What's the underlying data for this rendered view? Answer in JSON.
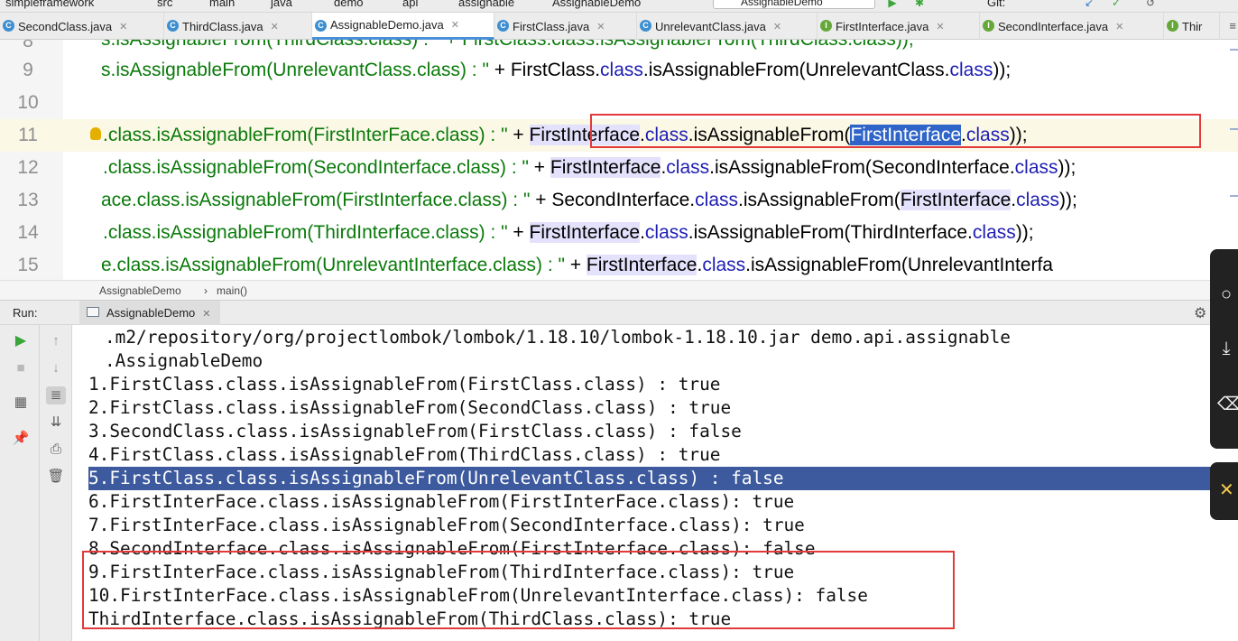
{
  "toolbar": {
    "breadcrumb": [
      "simpleframework",
      "src",
      "main",
      "java",
      "demo",
      "api",
      "assignable",
      "AssignableDemo"
    ],
    "run_config": "AssignableDemo",
    "git_label": "Git:"
  },
  "tabs": [
    {
      "label": "SecondClass.java",
      "kind": "C"
    },
    {
      "label": "ThirdClass.java",
      "kind": "C"
    },
    {
      "label": "AssignableDemo.java",
      "kind": "C",
      "active": true
    },
    {
      "label": "FirstClass.java",
      "kind": "C"
    },
    {
      "label": "UnrelevantClass.java",
      "kind": "C"
    },
    {
      "label": "FirstInterface.java",
      "kind": "I"
    },
    {
      "label": "SecondInterface.java",
      "kind": "I"
    },
    {
      "label": "Thir",
      "kind": "I"
    }
  ],
  "tab_overflow": "≡",
  "editor": {
    "line_numbers": [
      "8",
      "9",
      "10",
      "11",
      "12",
      "13",
      "14",
      "15"
    ],
    "line8": {
      "a": "s.isAssignableFrom(ThirdClass.class) : \" + FirstClass.class.isAssignableFrom(ThirdClass.class));"
    },
    "line9": {
      "s": "s.isAssignableFrom(UnrelevantClass.class) : \"",
      "plus": " + ",
      "a": "FirstClass.",
      "k1": "class",
      "b": ".isAssignableFrom(UnrelevantClass.",
      "k2": "class",
      "c": "));"
    },
    "line11": {
      "s": ".class.isAssignableFrom(FirstInterFace.class) : \"",
      "plus": " + ",
      "a": "FirstInterface",
      "dot": ".",
      "k1": "class",
      "b": ".isAssignableFrom(",
      "sel": "FirstInterface",
      "c": ".",
      "k2": "class",
      "d": "));"
    },
    "line12": {
      "s": ".class.isAssignableFrom(SecondInterface.class) : \"",
      "plus": " + ",
      "a": "FirstInterface",
      "dot": ".",
      "k1": "class",
      "b": ".isAssignableFrom(SecondInterface.",
      "k2": "class",
      "c": "));"
    },
    "line13": {
      "s": "ace.class.isAssignableFrom(FirstInterface.class) : \"",
      "plus": " + ",
      "a": "SecondInterface.",
      "k1": "class",
      "b": ".isAssignableFrom(",
      "h": "FirstInterface",
      "c": ".",
      "k2": "class",
      "d": "));"
    },
    "line14": {
      "s": ".class.isAssignableFrom(ThirdInterface.class) : \"",
      "plus": " + ",
      "a": "FirstInterface",
      "dot": ".",
      "k1": "class",
      "b": ".isAssignableFrom(ThirdInterface.",
      "k2": "class",
      "c": "));"
    },
    "line15": {
      "s": "e.class.isAssignableFrom(UnrelevantInterface.class) : \"",
      "plus": " + ",
      "a": "FirstInterface",
      "dot": ".",
      "k1": "class",
      "b": ".isAssignableFrom(UnrelevantInterfa"
    },
    "breadcrumb": {
      "file": "AssignableDemo",
      "sep": "›",
      "method": "main()"
    }
  },
  "run": {
    "label": "Run:",
    "tab": "AssignableDemo",
    "console_lines": [
      ".m2/repository/org/projectlombok/lombok/1.18.10/lombok-1.18.10.jar demo.api.assignable",
      ".AssignableDemo",
      "1.FirstClass.class.isAssignableFrom(FirstClass.class) : true",
      "2.FirstClass.class.isAssignableFrom(SecondClass.class) : true",
      "3.SecondClass.class.isAssignableFrom(FirstClass.class) : false",
      "4.FirstClass.class.isAssignableFrom(ThirdClass.class) : true",
      "5.FirstClass.class.isAssignableFrom(UnrelevantClass.class) : false",
      "6.FirstInterFace.class.isAssignableFrom(FirstInterFace.class): true",
      "7.FirstInterFace.class.isAssignableFrom(SecondInterface.class): true",
      "8.SecondInterface.class.isAssignableFrom(FirstInterface.class): false",
      "9.FirstInterFace.class.isAssignableFrom(ThirdInterface.class): true",
      "10.FirstInterFace.class.isAssignableFrom(UnrelevantInterface.class): false",
      "ThirdInterface.class.isAssignableFrom(ThirdClass.class): true"
    ],
    "selected_line_index": 6
  },
  "colors": {
    "string": "#0a7a0a",
    "keyword": "#1d1db3",
    "selection": "#2f65c8",
    "console_selection": "#3d5a9e",
    "annotation_box": "#e23a3a"
  },
  "icons": [
    "rerun-icon",
    "stop-icon",
    "up-arrow-icon",
    "down-arrow-icon",
    "soft-wrap-icon",
    "scroll-to-end-icon",
    "print-icon",
    "trash-icon",
    "layout-icon",
    "pin-icon",
    "gear-icon",
    "bulb-icon"
  ]
}
